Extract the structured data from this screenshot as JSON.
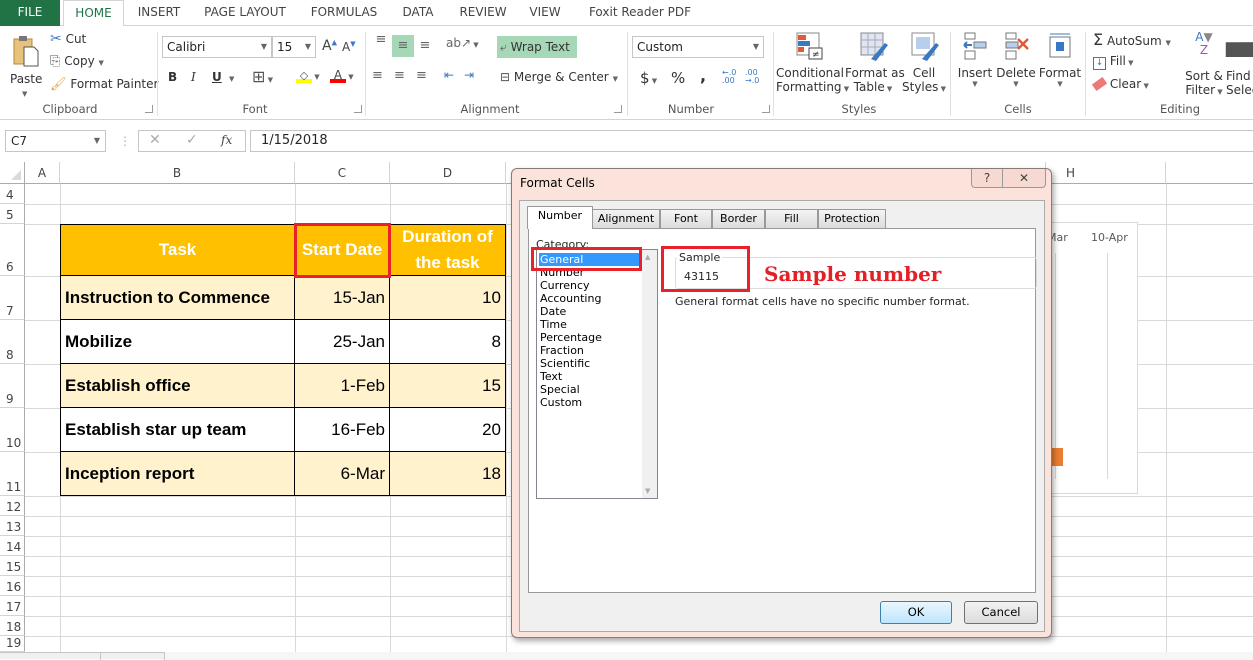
{
  "ribbon": {
    "tabs": [
      "FILE",
      "HOME",
      "INSERT",
      "PAGE LAYOUT",
      "FORMULAS",
      "DATA",
      "REVIEW",
      "VIEW",
      "Foxit Reader PDF"
    ],
    "active_tab": "HOME",
    "clipboard": {
      "paste": "Paste",
      "cut": "Cut",
      "copy": "Copy",
      "format_painter": "Format Painter",
      "label": "Clipboard"
    },
    "font": {
      "name": "Calibri",
      "size": "15",
      "bold": "B",
      "italic": "I",
      "underline": "U",
      "label": "Font",
      "fill_color": "#ffff00",
      "font_color": "#ff0000"
    },
    "alignment": {
      "wrap_text": "Wrap Text",
      "merge_center": "Merge & Center",
      "label": "Alignment"
    },
    "number": {
      "format": "Custom",
      "currency": "$",
      "percent": "%",
      "comma": ",",
      "label": "Number"
    },
    "styles": {
      "conditional": [
        "Conditional",
        "Formatting"
      ],
      "format_table": [
        "Format as",
        "Table"
      ],
      "cell_styles": [
        "Cell",
        "Styles"
      ],
      "label": "Styles"
    },
    "cells": {
      "insert": "Insert",
      "delete": "Delete",
      "format": "Format",
      "label": "Cells"
    },
    "editing": {
      "autosum": "AutoSum",
      "fill": "Fill",
      "clear": "Clear",
      "sort": [
        "Sort &",
        "Filter"
      ],
      "find": [
        "Find &",
        "Select"
      ],
      "label": "Editing"
    }
  },
  "formula_bar": {
    "name_box": "C7",
    "formula": "1/15/2018",
    "fx": "fx",
    "cancel": "✕",
    "enter": "✓"
  },
  "grid": {
    "columns": [
      "A",
      "B",
      "C",
      "D",
      "H"
    ],
    "rows": [
      "4",
      "5",
      "6",
      "7",
      "8",
      "9",
      "10",
      "11",
      "12",
      "13",
      "14",
      "15",
      "16",
      "17",
      "18",
      "19"
    ],
    "table": {
      "headers": [
        "Task",
        "Start Date",
        "Duration of the task"
      ],
      "rows": [
        [
          "Instruction to Commence",
          "15-Jan",
          "10"
        ],
        [
          "Mobilize",
          "25-Jan",
          "8"
        ],
        [
          "Establish office",
          "1-Feb",
          "15"
        ],
        [
          "Establish star up team",
          "16-Feb",
          "20"
        ],
        [
          "Inception report",
          "6-Mar",
          "18"
        ]
      ]
    },
    "chart_labels": [
      "-Mar",
      "10-Apr"
    ]
  },
  "dialog": {
    "title": "Format Cells",
    "help": "?",
    "close": "✕",
    "tabs": [
      "Number",
      "Alignment",
      "Font",
      "Border",
      "Fill",
      "Protection"
    ],
    "active_tab": "Number",
    "category_label": "Category:",
    "categories": [
      "General",
      "Number",
      "Currency",
      "Accounting",
      "Date",
      "Time",
      "Percentage",
      "Fraction",
      "Scientific",
      "Text",
      "Special",
      "Custom"
    ],
    "selected_category": "General",
    "sample_label": "Sample",
    "sample_value": "43115",
    "description": "General format cells have no specific number format.",
    "ok": "OK",
    "cancel": "Cancel"
  },
  "annotation": {
    "text": "Sample number",
    "color": "#e32026"
  }
}
